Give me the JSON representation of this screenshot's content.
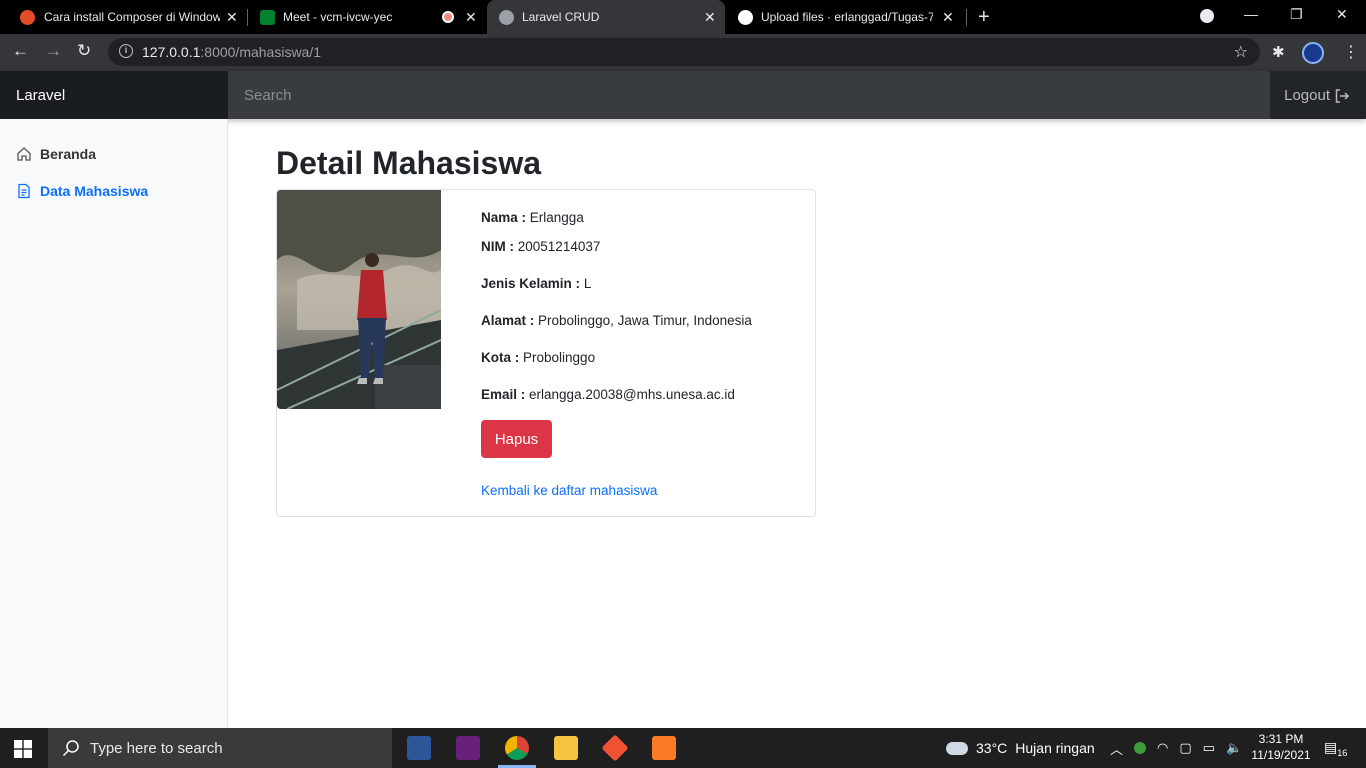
{
  "browser": {
    "tabs": [
      {
        "title": "Cara install Composer di Window",
        "favicon_color": "#e44d26"
      },
      {
        "title": "Meet - vcm-ivcw-yec",
        "favicon_color": "#00832d"
      },
      {
        "title": "Laravel CRUD",
        "favicon_color": "#9aa0a6",
        "active": true
      },
      {
        "title": "Upload files · erlanggad/Tugas-7",
        "favicon_color": "#ffffff"
      }
    ],
    "url_host": "127.0.0.1",
    "url_path": ":8000/mahasiswa/1"
  },
  "navbar": {
    "brand": "Laravel",
    "search_placeholder": "Search",
    "logout_label": "Logout"
  },
  "sidebar": {
    "items": [
      {
        "label": "Beranda",
        "icon": "home-icon"
      },
      {
        "label": "Data Mahasiswa",
        "icon": "file-text-icon",
        "active": true
      }
    ]
  },
  "main": {
    "title": "Detail Mahasiswa",
    "fields": [
      {
        "label": "Nama :",
        "value": "Erlangga"
      },
      {
        "label": "NIM :",
        "value": "20051214037"
      },
      {
        "label": "Jenis Kelamin :",
        "value": "L"
      },
      {
        "label": "Alamat :",
        "value": "Probolinggo, Jawa Timur, Indonesia"
      },
      {
        "label": "Kota :",
        "value": "Probolinggo"
      },
      {
        "label": "Email :",
        "value": "erlangga.20038@mhs.unesa.ac.id"
      }
    ],
    "delete_button": "Hapus",
    "back_link": "Kembali ke daftar mahasiswa"
  },
  "taskbar": {
    "search_placeholder": "Type here to search",
    "weather_temp": "33°C",
    "weather_desc": "Hujan ringan",
    "time": "3:31 PM",
    "date": "11/19/2021",
    "notification_count": "16"
  },
  "colors": {
    "accent": "#0d6efd",
    "danger": "#dc3545",
    "navbar": "#212529"
  }
}
